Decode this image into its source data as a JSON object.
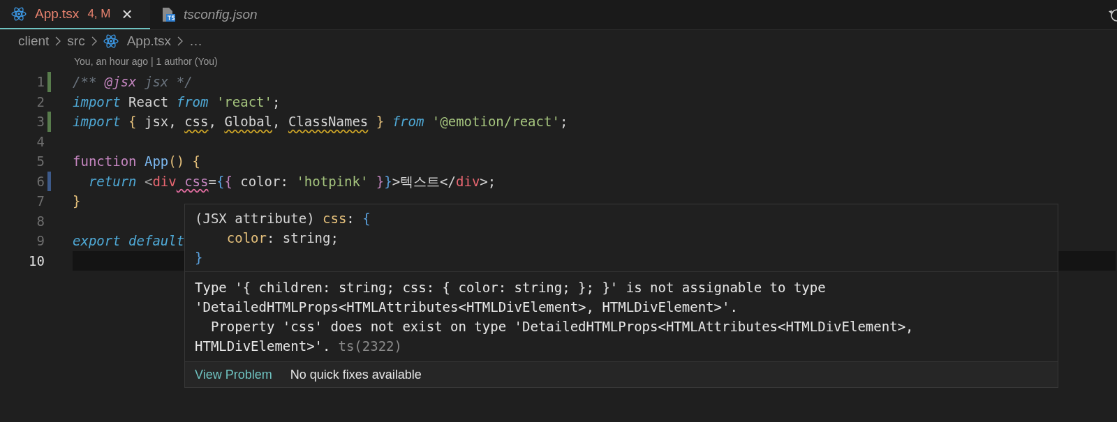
{
  "tabs": [
    {
      "label": "App.tsx",
      "badge": "4, M",
      "selected": true,
      "italic": false,
      "close": "×"
    },
    {
      "label": "tsconfig.json",
      "selected": false,
      "italic": true
    }
  ],
  "breadcrumb": [
    {
      "text": "client",
      "kind": "folder"
    },
    {
      "text": "src",
      "kind": "folder"
    },
    {
      "text": "App.tsx",
      "kind": "file"
    },
    {
      "text": "…",
      "kind": "more"
    }
  ],
  "codelens": "You, an hour ago | 1 author (You)",
  "lines": [
    {
      "number": "1",
      "added": true,
      "modified": false,
      "current": false,
      "tokens": [
        {
          "text": "/** ",
          "kind": "comment"
        },
        {
          "text": "@jsx",
          "kind": "tagdoc"
        },
        {
          "text": " jsx */",
          "kind": "comment"
        }
      ]
    },
    {
      "number": "2",
      "added": false,
      "modified": false,
      "current": false,
      "tokens": [
        {
          "text": "import",
          "kind": "keyword"
        },
        {
          "text": " React ",
          "kind": "plain"
        },
        {
          "text": "from",
          "kind": "keyword"
        },
        {
          "text": " 'react'",
          "kind": "string"
        },
        {
          "text": ";",
          "kind": "plain"
        }
      ]
    },
    {
      "number": "3",
      "added": true,
      "modified": false,
      "current": false,
      "tokens": [
        {
          "text": "import",
          "kind": "keyword"
        },
        {
          "text": " {",
          "kind": "brace"
        },
        {
          "text": " jsx, ",
          "kind": "plain"
        },
        {
          "text": "css",
          "kind": "plain",
          "warning": true
        },
        {
          "text": ", ",
          "kind": "plain"
        },
        {
          "text": "Global",
          "kind": "plain",
          "warning": true
        },
        {
          "text": ", ",
          "kind": "plain"
        },
        {
          "text": "ClassNames",
          "kind": "plain",
          "warning": true
        },
        {
          "text": " }",
          "kind": "brace"
        },
        {
          "text": " from",
          "kind": "keyword"
        },
        {
          "text": " '@emotion/react'",
          "kind": "string"
        },
        {
          "text": ";",
          "kind": "plain"
        }
      ]
    },
    {
      "number": "4",
      "added": false,
      "modified": false,
      "current": false
    },
    {
      "number": "5",
      "added": false,
      "modified": false,
      "current": false,
      "tokens": [
        {
          "text": "function",
          "kind": "storage"
        },
        {
          "text": " App",
          "kind": "func"
        },
        {
          "text": "()",
          "kind": "brace"
        },
        {
          "text": " {",
          "kind": "brace"
        }
      ]
    },
    {
      "number": "6",
      "added": false,
      "modified": true,
      "current": false,
      "tokens": [
        {
          "text": "  return",
          "kind": "keyword"
        },
        {
          "text": " <",
          "kind": "punct"
        },
        {
          "text": "div",
          "kind": "tag"
        },
        {
          "text": " css",
          "kind": "attr",
          "error": true
        },
        {
          "text": "=",
          "kind": "plain"
        },
        {
          "text": "{",
          "kind": "brace2"
        },
        {
          "text": "{",
          "kind": "brace3"
        },
        {
          "text": " color: ",
          "kind": "plain"
        },
        {
          "text": "'hotpink'",
          "kind": "string"
        },
        {
          "text": " }",
          "kind": "brace3"
        },
        {
          "text": "}",
          "kind": "brace2"
        },
        {
          "text": ">텍스트</",
          "kind": "plain"
        },
        {
          "text": "div",
          "kind": "tag"
        },
        {
          "text": ">;",
          "kind": "plain"
        }
      ]
    },
    {
      "number": "7",
      "added": false,
      "modified": false,
      "current": false,
      "tokens": [
        {
          "text": "}",
          "kind": "brace"
        }
      ]
    },
    {
      "number": "8",
      "added": false,
      "modified": false,
      "current": false
    },
    {
      "number": "9",
      "added": false,
      "modified": false,
      "current": false,
      "tokens": [
        {
          "text": "export",
          "kind": "keyword"
        },
        {
          "text": " default",
          "kind": "keyword"
        }
      ]
    },
    {
      "number": "10",
      "added": false,
      "modified": false,
      "current": true
    }
  ],
  "hover": {
    "signature": [
      [
        {
          "text": "(JSX attribute) ",
          "kind": "plain"
        },
        {
          "text": "css",
          "kind": "prop"
        },
        {
          "text": ": ",
          "kind": "plain"
        },
        {
          "text": "{",
          "kind": "brace2"
        }
      ],
      [
        {
          "text": "    color",
          "kind": "prop"
        },
        {
          "text": ": string;",
          "kind": "plain"
        }
      ],
      [
        {
          "text": "}",
          "kind": "brace2"
        }
      ]
    ],
    "message": [
      "Type '{ children: string; css: { color: string; }; }' is not assignable to type",
      "'DetailedHTMLProps<HTMLAttributes<HTMLDivElement>, HTMLDivElement>'.",
      "  Property 'css' does not exist on type 'DetailedHTMLProps<HTMLAttributes<HTMLDivElement>,",
      "HTMLDivElement>'."
    ],
    "source": "ts(2322)",
    "link": "View Problem",
    "note": "No quick fixes available"
  }
}
